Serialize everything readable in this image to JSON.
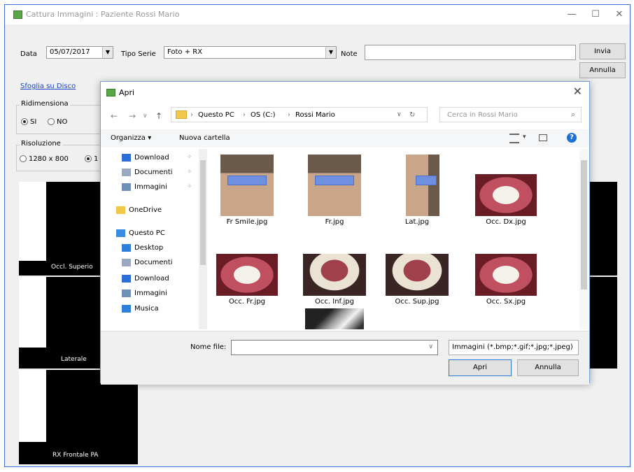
{
  "window": {
    "title": "Cattura Immagini : Paziente Rossi Mario",
    "minimize_glyph": "—",
    "maximize_glyph": "☐",
    "close_glyph": "✕",
    "app_icon": "camera-app-icon"
  },
  "form": {
    "date_label": "Data",
    "date_value": "05/07/2017",
    "series_label": "Tipo Serie",
    "series_value": "Foto + RX",
    "note_label": "Note",
    "note_value": "",
    "send_button": "Invia",
    "cancel_button": "Annulla",
    "browse_link": "Sfoglia su Disco",
    "resize_group": "Ridimensiona",
    "resize_yes": "SI",
    "resize_no": "NO",
    "resolution_group": "Risoluzione",
    "res_option_1": "1280 x 800",
    "res_option_2": "1"
  },
  "panels": [
    {
      "caption": "Occl. Superio"
    },
    {
      "caption": "Laterale"
    },
    {
      "caption": "RX Frontale PA"
    }
  ],
  "dialog": {
    "title": "Apri",
    "close_glyph": "✕",
    "path": {
      "sep": "›",
      "segments": [
        "Questo PC",
        "OS (C:)",
        "Rossi Mario"
      ]
    },
    "search_placeholder": "Cerca in Rossi Mario",
    "organize": "Organizza ▾",
    "new_folder": "Nuova cartella",
    "tree": [
      {
        "label": "Download",
        "icon": "download-icon",
        "pinned": true
      },
      {
        "label": "Documenti",
        "icon": "documents-icon",
        "pinned": true
      },
      {
        "label": "Immagini",
        "icon": "pictures-icon",
        "pinned": true
      },
      {
        "label": "OneDrive",
        "icon": "onedrive-icon",
        "pinned": false
      },
      {
        "label": "Questo PC",
        "icon": "computer-icon",
        "pinned": false
      },
      {
        "label": "Desktop",
        "icon": "desktop-icon",
        "pinned": false
      },
      {
        "label": "Documenti",
        "icon": "documents-icon",
        "pinned": false
      },
      {
        "label": "Download",
        "icon": "download-icon",
        "pinned": false
      },
      {
        "label": "Immagini",
        "icon": "pictures-icon",
        "pinned": false
      },
      {
        "label": "Musica",
        "icon": "music-icon",
        "pinned": false
      }
    ],
    "files": [
      {
        "name": "Fr Smile.jpg",
        "kind": "face"
      },
      {
        "name": "Fr.jpg",
        "kind": "face"
      },
      {
        "name": "Lat.jpg",
        "kind": "profile"
      },
      {
        "name": "Occ. Dx.jpg",
        "kind": "mouth"
      },
      {
        "name": "Occ. Fr.jpg",
        "kind": "mouth"
      },
      {
        "name": "Occ. Inf.jpg",
        "kind": "arch"
      },
      {
        "name": "Occ. Sup.jpg",
        "kind": "arch"
      },
      {
        "name": "Occ. Sx.jpg",
        "kind": "mouth"
      },
      {
        "name": "",
        "kind": "partial"
      },
      {
        "name": "",
        "kind": "xray"
      }
    ],
    "filename_label": "Nome file:",
    "filename_value": "",
    "filetype_value": "Immagini (*.bmp;*.gif;*.jpg;*.jpeg)",
    "open_button": "Apri",
    "cancel_button": "Annulla"
  }
}
